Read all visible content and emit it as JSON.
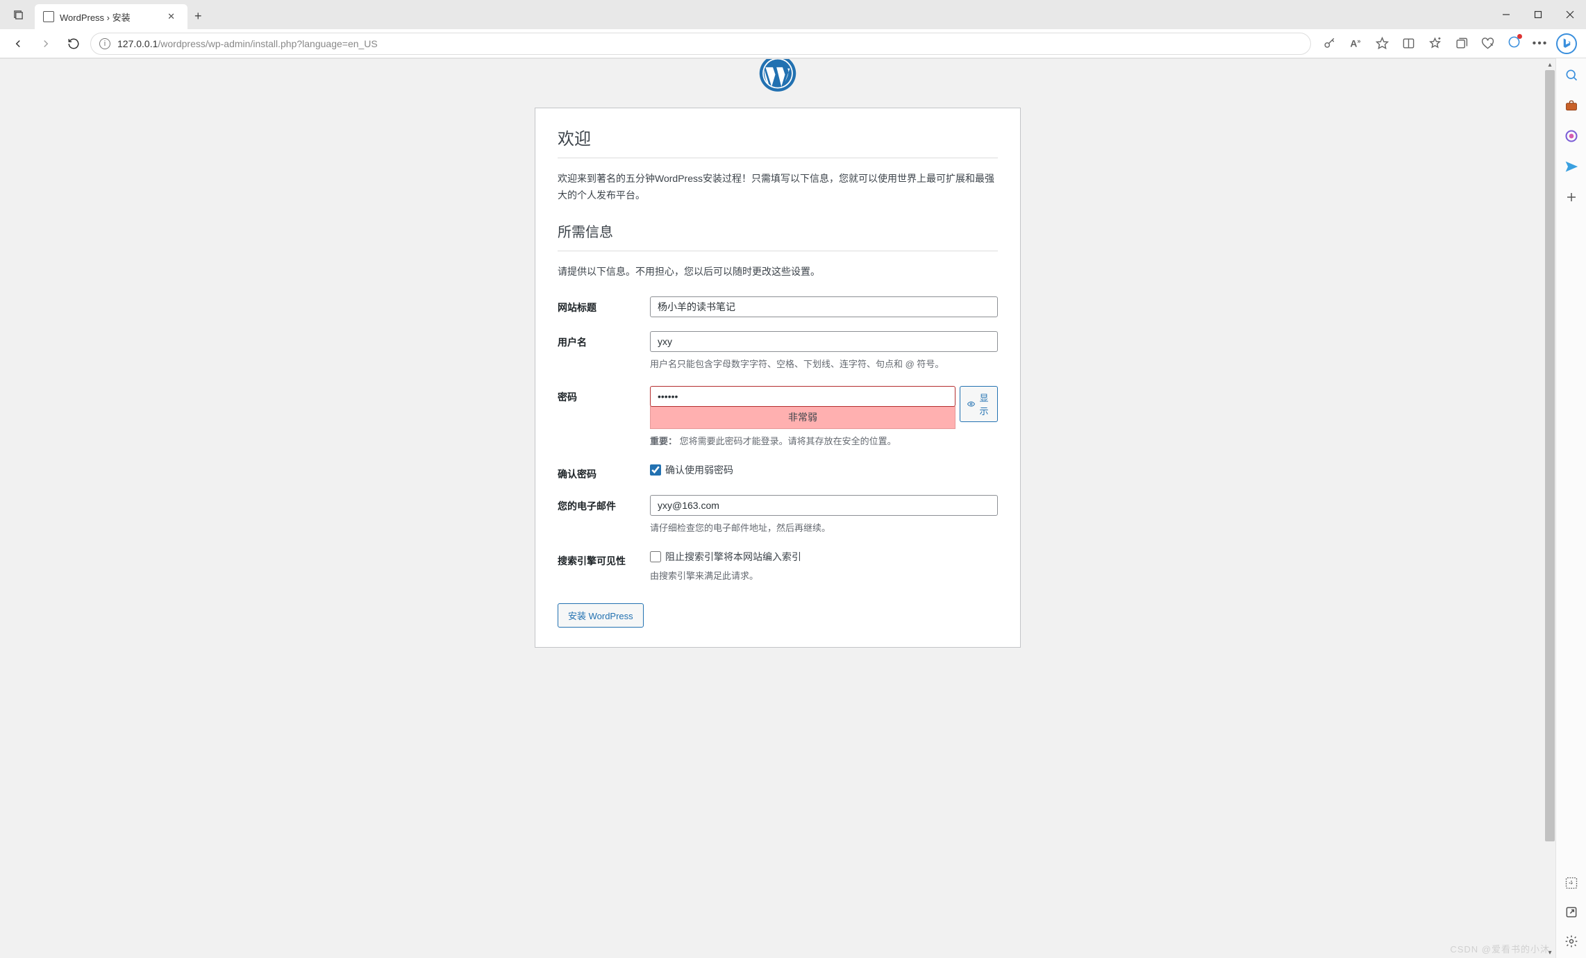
{
  "browser": {
    "tab_title": "WordPress › 安装",
    "url_host": "127.0.0.1",
    "url_path": "/wordpress/wp-admin/install.php?language=en_US"
  },
  "page": {
    "heading_welcome": "欢迎",
    "welcome_text": "欢迎来到著名的五分钟WordPress安装过程！只需填写以下信息，您就可以使用世界上最可扩展和最强大的个人发布平台。",
    "heading_info": "所需信息",
    "info_text": "请提供以下信息。不用担心，您以后可以随时更改这些设置。",
    "labels": {
      "site_title": "网站标题",
      "username": "用户名",
      "password": "密码",
      "confirm_pwd": "确认密码",
      "email": "您的电子邮件",
      "search_vis": "搜索引擎可见性"
    },
    "values": {
      "site_title": "杨小羊的读书笔记",
      "username": "yxy",
      "password": "••••••",
      "email": "yxy@163.com"
    },
    "hints": {
      "username": "用户名只能包含字母数字字符、空格、下划线、连字符、句点和 @ 符号。",
      "password_strength": "非常弱",
      "password_important_label": "重要：",
      "password_important": "您将需要此密码才能登录。请将其存放在安全的位置。",
      "confirm_weak": "确认使用弱密码",
      "email": "请仔细检查您的电子邮件地址，然后再继续。",
      "search_vis_check": "阻止搜索引擎将本网站编入索引",
      "search_vis_note": "由搜索引擎来满足此请求。"
    },
    "buttons": {
      "show": "显示",
      "install": "安装 WordPress"
    }
  },
  "watermark": "CSDN @爱看书的小沐"
}
